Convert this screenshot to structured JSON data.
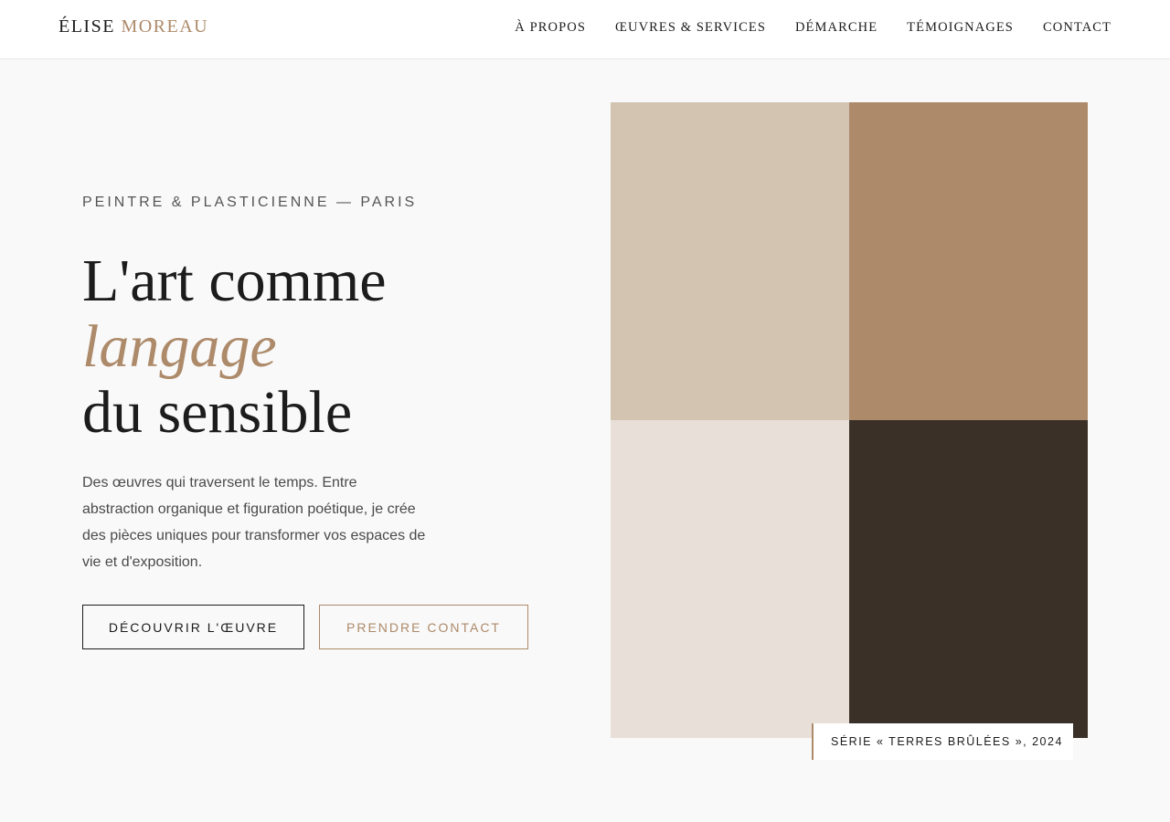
{
  "header": {
    "logo_first": "ÉLISE",
    "logo_second": "MOREAU",
    "nav": [
      {
        "label": "À PROPOS"
      },
      {
        "label": "ŒUVRES & SERVICES"
      },
      {
        "label": "DÉMARCHE"
      },
      {
        "label": "TÉMOIGNAGES"
      },
      {
        "label": "CONTACT"
      }
    ]
  },
  "hero": {
    "eyebrow": "PEINTRE & PLASTICIENNE — PARIS",
    "headline_line1": "L'art comme",
    "headline_line2": "langage",
    "headline_line3": "du sensible",
    "intro": "Des œuvres qui traversent le temps. Entre abstraction organique et figuration poétique, je crée des pièces uniques pour transformer vos espaces de vie et d'exposition.",
    "primary_button": "DÉCOUVRIR L'ŒUVRE",
    "secondary_button": "PRENDRE CONTACT"
  },
  "artwork": {
    "tiles": [
      {
        "color": "#d3c4b2"
      },
      {
        "color": "#ad8a6a"
      },
      {
        "color": "#e8e0d8"
      },
      {
        "color": "#3a3028"
      }
    ],
    "caption": "SÉRIE « TERRES BRÛLÉES », 2024"
  },
  "colors": {
    "accent": "#ad8a6a",
    "text": "#1c1c1c",
    "background": "#f9f9f9"
  }
}
